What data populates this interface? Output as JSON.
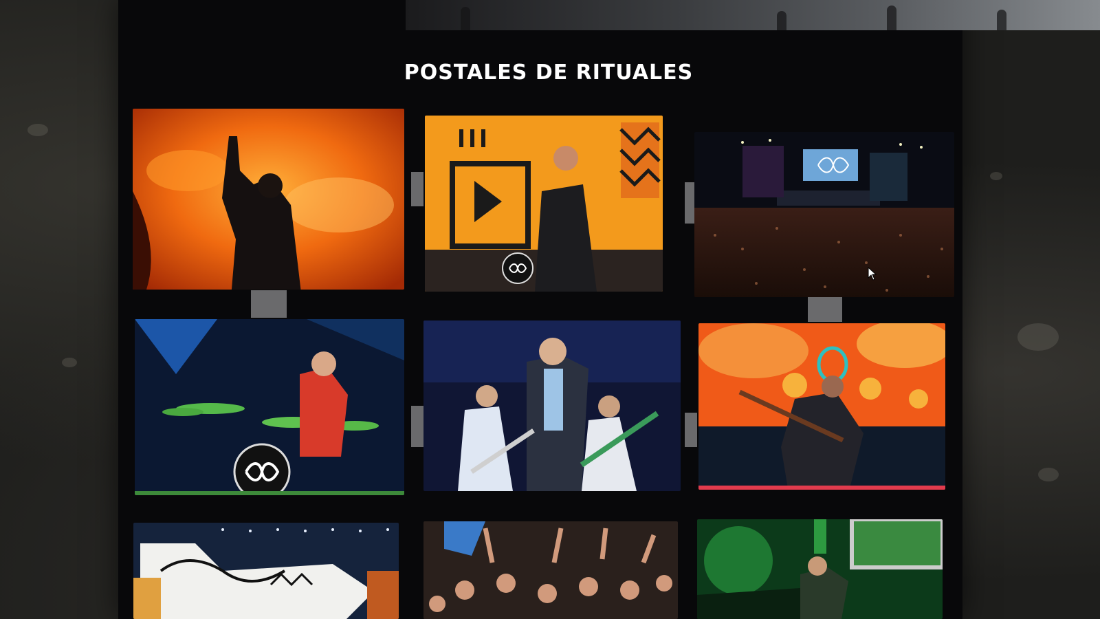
{
  "section": {
    "title": "POSTALES DE RITUALES"
  },
  "gallery": {
    "photos": [
      {
        "subject": "singer raising fist against orange fire background"
      },
      {
        "subject": "guitarist with orange graphic backdrop and drummer"
      },
      {
        "subject": "wide stadium stage with crowd and infinity screen"
      },
      {
        "subject": "drummer with green cymbals and infinity bass drum"
      },
      {
        "subject": "singer in Argentina jersey with guitarists"
      },
      {
        "subject": "guitarist kneeling with colorful orange stage art"
      },
      {
        "subject": "cartoon character backdrop on stage"
      },
      {
        "subject": "crowd with raised hands"
      },
      {
        "subject": "drummer under green lights"
      }
    ]
  },
  "icons": {
    "cursor": "mouse-pointer-icon",
    "infinity": "infinity-logo-icon"
  },
  "colors": {
    "page_bg": "#08080a",
    "title": "#ffffff",
    "accent_orange": "#f07a12",
    "accent_green": "#3fae3a"
  }
}
